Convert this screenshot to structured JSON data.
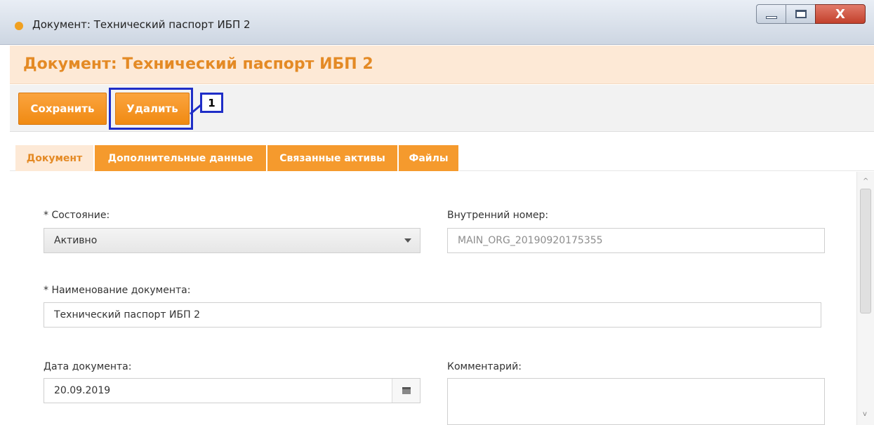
{
  "window": {
    "title": "Документ: Технический паспорт ИБП 2",
    "controls": {
      "close_glyph": "X"
    }
  },
  "header": {
    "title": "Документ: Технический паспорт ИБП 2"
  },
  "toolbar": {
    "save_label": "Сохранить",
    "delete_label": "Удалить",
    "callout_number": "1",
    "highlight_color": "#1f2ec7"
  },
  "tabs": [
    {
      "label": "Документ",
      "active": true
    },
    {
      "label": "Дополнительные данные",
      "active": false
    },
    {
      "label": "Связанные активы",
      "active": false
    },
    {
      "label": "Файлы",
      "active": false
    }
  ],
  "form": {
    "status": {
      "label": "* Состояние:",
      "value": "Активно"
    },
    "internal_number": {
      "label": "Внутренний номер:",
      "value": "MAIN_ORG_20190920175355"
    },
    "doc_name": {
      "label": "* Наименование документа:",
      "value": "Технический паспорт ИБП 2"
    },
    "doc_date": {
      "label": "Дата документа:",
      "value": "20.09.2019"
    },
    "comment": {
      "label": "Комментарий:",
      "value": ""
    }
  },
  "colors": {
    "accent": "#f59a2d",
    "header_bg": "#fde9d6",
    "header_text": "#e48a25"
  }
}
